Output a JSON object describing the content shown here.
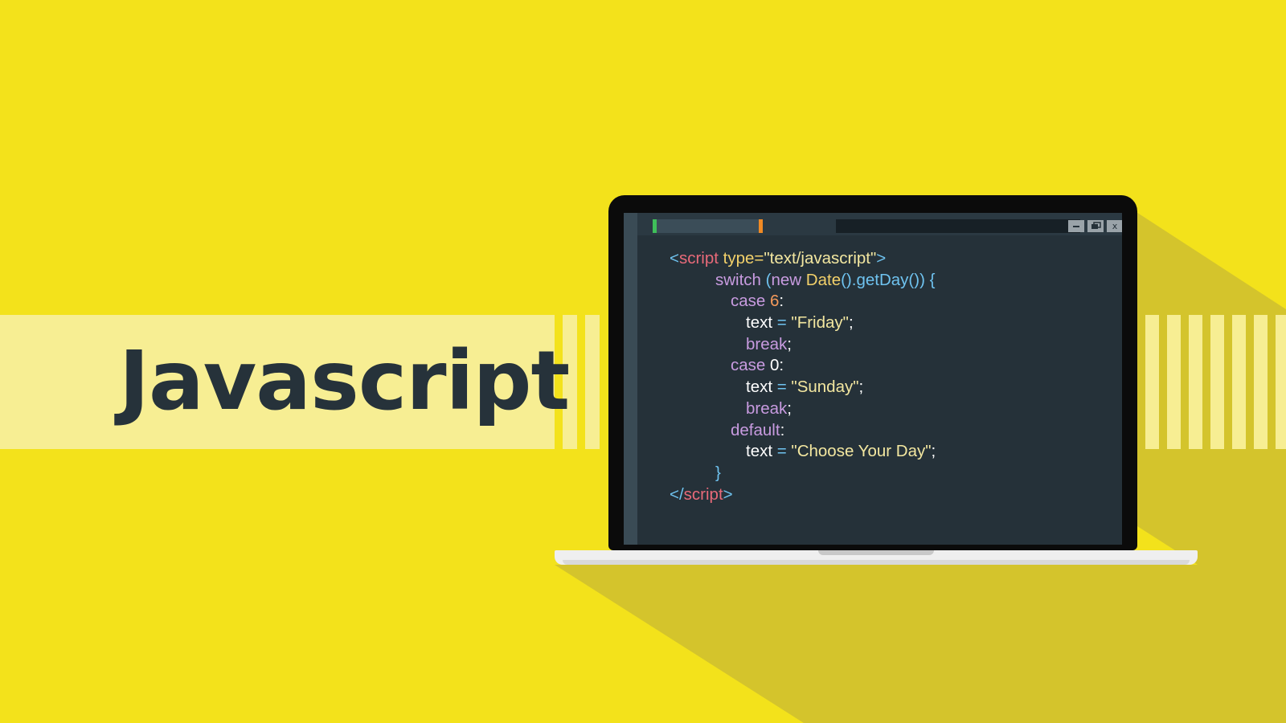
{
  "heading": "Javascript",
  "colors": {
    "background": "#f3e21b",
    "banner": "#f7ee93",
    "heading_text": "#26323a",
    "editor_background": "#253139",
    "token_tag": "#e86a79",
    "token_punct": "#6fc3f0",
    "token_attr": "#f3d16a",
    "token_string": "#f3e7a0",
    "token_keyword": "#c89be0",
    "token_func": "#f3d16a",
    "token_number": "#f59a5b",
    "token_plain": "#ffffff"
  },
  "window_controls": {
    "minimize_icon": "minimize-icon",
    "restore_icon": "restore-icon",
    "close_label": "x"
  },
  "code_lines": [
    {
      "indent": 0,
      "tokens": [
        {
          "t": "<",
          "c": "token_punct"
        },
        {
          "t": "script",
          "c": "token_tag"
        },
        {
          "t": " type=",
          "c": "token_attr"
        },
        {
          "t": "\"text/javascript\"",
          "c": "token_string"
        },
        {
          "t": ">",
          "c": "token_punct"
        }
      ]
    },
    {
      "indent": 3,
      "tokens": [
        {
          "t": "switch ",
          "c": "token_keyword"
        },
        {
          "t": "(",
          "c": "token_punct"
        },
        {
          "t": "new ",
          "c": "token_keyword"
        },
        {
          "t": "Date",
          "c": "token_func"
        },
        {
          "t": "().getDay()) {",
          "c": "token_punct"
        }
      ]
    },
    {
      "indent": 4,
      "tokens": [
        {
          "t": "case ",
          "c": "token_keyword"
        },
        {
          "t": "6",
          "c": "token_number"
        },
        {
          "t": ":",
          "c": "token_plain"
        }
      ]
    },
    {
      "indent": 5,
      "tokens": [
        {
          "t": "text",
          "c": "token_plain"
        },
        {
          "t": " = ",
          "c": "token_punct"
        },
        {
          "t": "\"Friday\"",
          "c": "token_string"
        },
        {
          "t": ";",
          "c": "token_plain"
        }
      ]
    },
    {
      "indent": 5,
      "tokens": [
        {
          "t": "break",
          "c": "token_keyword"
        },
        {
          "t": ";",
          "c": "token_plain"
        }
      ]
    },
    {
      "indent": 4,
      "tokens": [
        {
          "t": "case ",
          "c": "token_keyword"
        },
        {
          "t": "0",
          "c": "token_plain"
        },
        {
          "t": ":",
          "c": "token_plain"
        }
      ]
    },
    {
      "indent": 5,
      "tokens": [
        {
          "t": "text",
          "c": "token_plain"
        },
        {
          "t": " = ",
          "c": "token_punct"
        },
        {
          "t": "\"Sunday\"",
          "c": "token_string"
        },
        {
          "t": ";",
          "c": "token_plain"
        }
      ]
    },
    {
      "indent": 5,
      "tokens": [
        {
          "t": "break",
          "c": "token_keyword"
        },
        {
          "t": ";",
          "c": "token_plain"
        }
      ]
    },
    {
      "indent": 4,
      "tokens": [
        {
          "t": "default",
          "c": "token_keyword"
        },
        {
          "t": ":",
          "c": "token_plain"
        }
      ]
    },
    {
      "indent": 5,
      "tokens": [
        {
          "t": "text",
          "c": "token_plain"
        },
        {
          "t": " = ",
          "c": "token_punct"
        },
        {
          "t": "\"Choose Your Day\"",
          "c": "token_string"
        },
        {
          "t": ";",
          "c": "token_plain"
        }
      ]
    },
    {
      "indent": 3,
      "tokens": [
        {
          "t": "}",
          "c": "token_punct"
        }
      ]
    },
    {
      "indent": 0,
      "tokens": [
        {
          "t": "</",
          "c": "token_punct"
        },
        {
          "t": "script",
          "c": "token_tag"
        },
        {
          "t": ">",
          "c": "token_punct"
        }
      ]
    }
  ]
}
